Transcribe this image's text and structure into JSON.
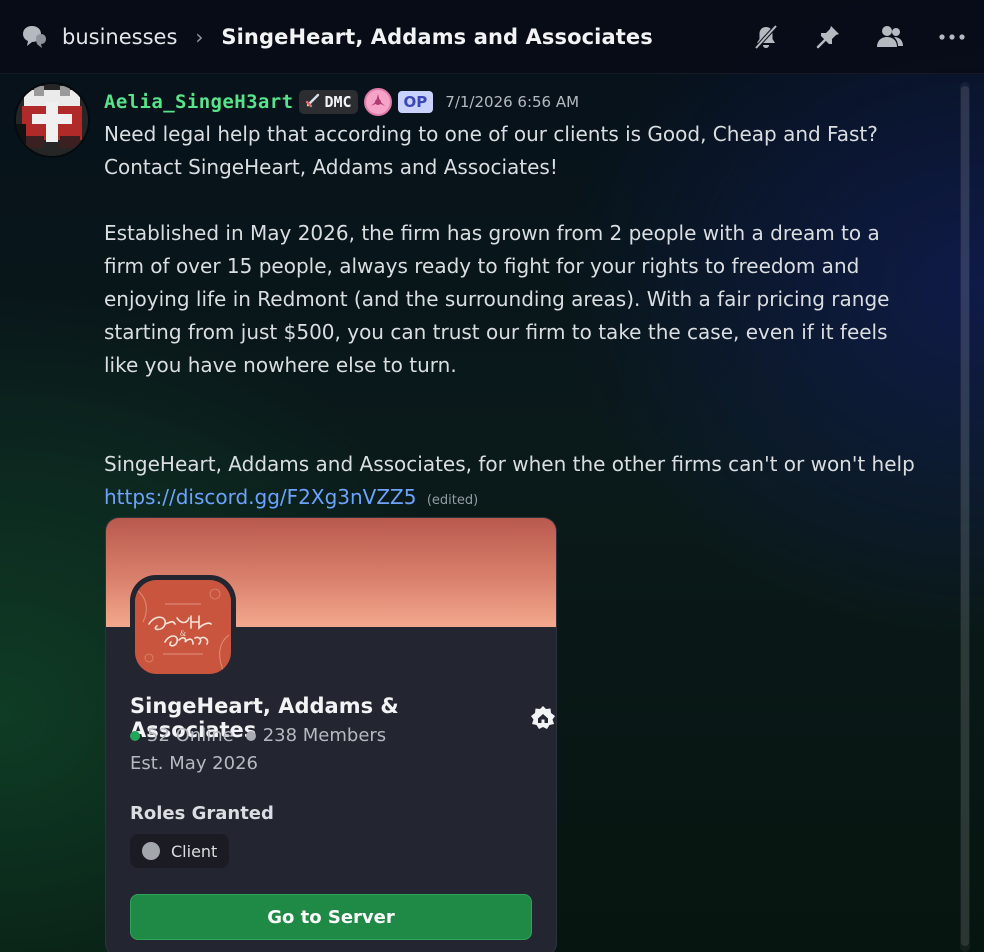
{
  "header": {
    "channel": "businesses",
    "separator": "›",
    "thread_title": "SingeHeart, Addams and Associates",
    "icons": [
      "forum-thread-icon",
      "mute-notifications-icon",
      "pin-icon",
      "members-icon",
      "more-options-icon"
    ]
  },
  "message": {
    "username": "Aelia_SingeH3art",
    "clan_tag": "DMC",
    "op_badge": "OP",
    "timestamp": "7/1/2026 6:56 AM",
    "paragraph_1": "Need legal help that according to one of our clients is Good, Cheap and Fast? Contact SingeHeart, Addams and Associates!",
    "paragraph_2": "Established in May 2026, the firm has grown from 2 people with a dream to a firm of over 15 people, always ready to fight for your rights to freedom and enjoying life in Redmont (and the surrounding areas). With a fair pricing range starting from just $500, you can trust our firm to take the case, even if it feels like you have nowhere else to turn.",
    "paragraph_3": "SingeHeart, Addams and Associates, for when the other firms can't or won't help",
    "link": "https://discord.gg/F2Xg3nVZZ5",
    "edited": "(edited)"
  },
  "invite": {
    "server_name": "SingeHeart, Addams & Associates",
    "online": "52 Online",
    "members": "238 Members",
    "established": "Est. May 2026",
    "roles_title": "Roles Granted",
    "role": "Client",
    "button": "Go to Server"
  },
  "colors": {
    "username": "#57e38a",
    "link": "#6ba3ff",
    "button": "#1f8a46",
    "online_dot": "#23a55a",
    "banner": "#d9806c"
  }
}
